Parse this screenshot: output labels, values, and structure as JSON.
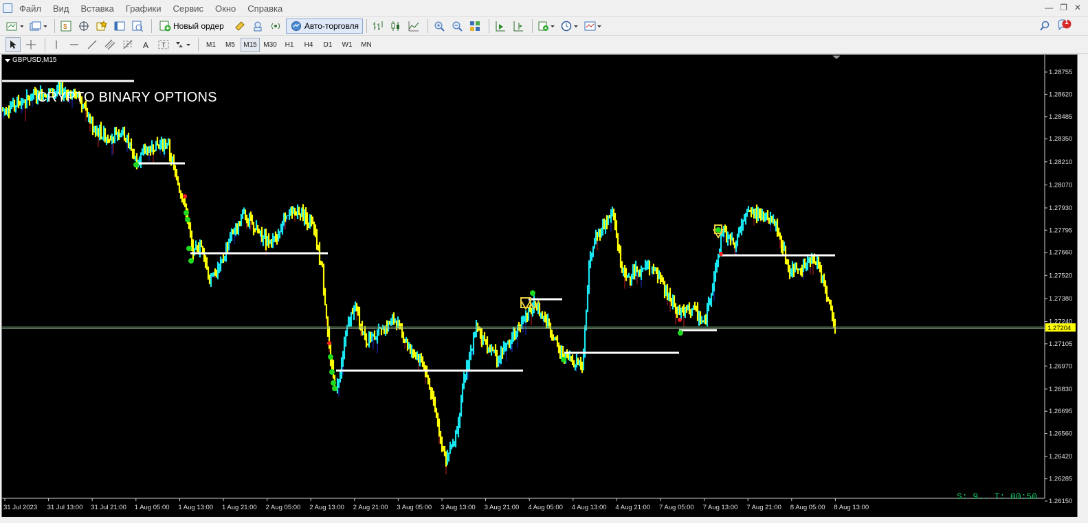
{
  "menu": {
    "items": [
      "Файл",
      "Вид",
      "Вставка",
      "Графики",
      "Сервис",
      "Окно",
      "Справка"
    ]
  },
  "toolbar": {
    "new_order_label": "Новый ордер",
    "autotrading_label": "Авто-торговля",
    "notification_count": "1"
  },
  "timeframes": {
    "items": [
      "M1",
      "M5",
      "M15",
      "M30",
      "H1",
      "H4",
      "D1",
      "W1",
      "MN"
    ],
    "active": "M15"
  },
  "chart": {
    "symbol_label": "GBPUSD,M15",
    "overlay_text": "CRYPTO BINARY OPTIONS",
    "status_text": "S: 9.. T: 00:50",
    "current_price": "1.27204",
    "background_color": "#000000",
    "bull_color": "#19e6f0",
    "bear_color": "#ffff00",
    "price_axis": [
      "1.28755",
      "1.28620",
      "1.28485",
      "1.28350",
      "1.28210",
      "1.28070",
      "1.27930",
      "1.27795",
      "1.27660",
      "1.27520",
      "1.27380",
      "1.27240",
      "1.27105",
      "1.26970",
      "1.26830",
      "1.26695",
      "1.26560",
      "1.26420",
      "1.26285",
      "1.26150"
    ],
    "time_axis": [
      "31 Jul 2023",
      "31 Jul 13:00",
      "31 Jul 21:00",
      "1 Aug 05:00",
      "1 Aug 13:00",
      "1 Aug 21:00",
      "2 Aug 05:00",
      "2 Aug 13:00",
      "2 Aug 21:00",
      "3 Aug 05:00",
      "3 Aug 13:00",
      "3 Aug 21:00",
      "4 Aug 05:00",
      "4 Aug 13:00",
      "4 Aug 21:00",
      "7 Aug 05:00",
      "7 Aug 13:00",
      "7 Aug 21:00",
      "8 Aug 05:00",
      "8 Aug 13:00"
    ]
  }
}
